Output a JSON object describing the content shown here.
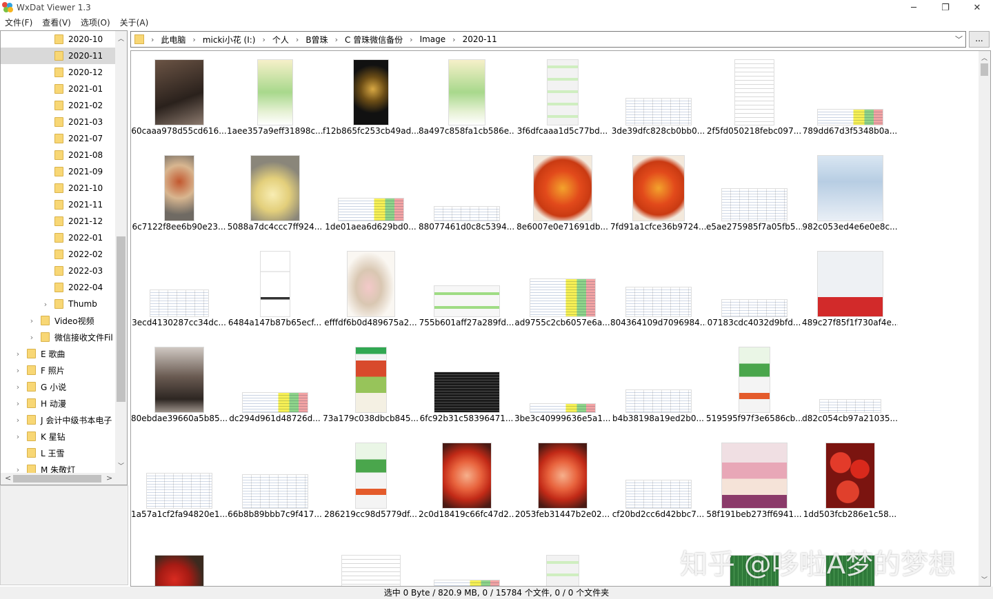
{
  "window": {
    "title": "WxDat Viewer 1.3",
    "controls": [
      "─",
      "❐",
      "✕"
    ]
  },
  "menu": [
    "文件(F)",
    "查看(V)",
    "选项(O)",
    "关于(A)"
  ],
  "tree": {
    "items": [
      {
        "label": "2020-10",
        "level": 4,
        "expander": false,
        "selected": false
      },
      {
        "label": "2020-11",
        "level": 4,
        "expander": false,
        "selected": true
      },
      {
        "label": "2020-12",
        "level": 4,
        "expander": false,
        "selected": false
      },
      {
        "label": "2021-01",
        "level": 4,
        "expander": false,
        "selected": false
      },
      {
        "label": "2021-02",
        "level": 4,
        "expander": false,
        "selected": false
      },
      {
        "label": "2021-03",
        "level": 4,
        "expander": false,
        "selected": false
      },
      {
        "label": "2021-07",
        "level": 4,
        "expander": false,
        "selected": false
      },
      {
        "label": "2021-08",
        "level": 4,
        "expander": false,
        "selected": false
      },
      {
        "label": "2021-09",
        "level": 4,
        "expander": false,
        "selected": false
      },
      {
        "label": "2021-10",
        "level": 4,
        "expander": false,
        "selected": false
      },
      {
        "label": "2021-11",
        "level": 4,
        "expander": false,
        "selected": false
      },
      {
        "label": "2021-12",
        "level": 4,
        "expander": false,
        "selected": false
      },
      {
        "label": "2022-01",
        "level": 4,
        "expander": false,
        "selected": false
      },
      {
        "label": "2022-02",
        "level": 4,
        "expander": false,
        "selected": false
      },
      {
        "label": "2022-03",
        "level": 4,
        "expander": false,
        "selected": false
      },
      {
        "label": "2022-04",
        "level": 4,
        "expander": false,
        "selected": false
      },
      {
        "label": "Thumb",
        "level": 4,
        "expander": true,
        "selected": false
      },
      {
        "label": "Video视频",
        "level": 3,
        "expander": true,
        "selected": false
      },
      {
        "label": "微信接收文件Fil",
        "level": 3,
        "expander": true,
        "selected": false
      },
      {
        "label": "E  歌曲",
        "level": 2,
        "expander": true,
        "selected": false
      },
      {
        "label": "F  照片",
        "level": 2,
        "expander": true,
        "selected": false
      },
      {
        "label": "G 小说",
        "level": 2,
        "expander": true,
        "selected": false
      },
      {
        "label": "H  动漫",
        "level": 2,
        "expander": true,
        "selected": false
      },
      {
        "label": "J  会计中级书本电子",
        "level": 2,
        "expander": true,
        "selected": false
      },
      {
        "label": "K  星钻",
        "level": 2,
        "expander": true,
        "selected": false
      },
      {
        "label": "L   王雪",
        "level": 2,
        "expander": false,
        "selected": false
      },
      {
        "label": "M  朱敬灯",
        "level": 2,
        "expander": true,
        "selected": false
      }
    ]
  },
  "address": {
    "crumbs": [
      "此电脑",
      "micki小花 (I:)",
      "个人",
      "B曾珠",
      "C  曾珠微信备份",
      "Image",
      "2020-11"
    ],
    "more_label": "..."
  },
  "files": [
    {
      "name": "60caaa978d55cd616...",
      "kind": "photo-dark",
      "w": 72,
      "h": 96
    },
    {
      "name": "1aee357a9eff31898c...",
      "kind": "game",
      "w": 52,
      "h": 96
    },
    {
      "name": "f12b865fc253cb49ad...",
      "kind": "black-gold",
      "w": 52,
      "h": 96
    },
    {
      "name": "8a497c858fa1cb586e...",
      "kind": "game",
      "w": 54,
      "h": 96
    },
    {
      "name": "3f6dfcaaa1d5c77bd...",
      "kind": "chat",
      "w": 46,
      "h": 96
    },
    {
      "name": "3de39dfc828cb0bb0...",
      "kind": "sheet",
      "w": 96,
      "h": 40
    },
    {
      "name": "2f5fd050218febc097...",
      "kind": "doc",
      "w": 58,
      "h": 96
    },
    {
      "name": "789dd67d3f5348b0a...",
      "kind": "sheet-color",
      "w": 96,
      "h": 24
    },
    {
      "name": "6c7122f8ee6b90e23...",
      "kind": "food",
      "w": 44,
      "h": 96
    },
    {
      "name": "5088a7dc4ccc7ff924...",
      "kind": "lemon",
      "w": 72,
      "h": 96
    },
    {
      "name": "1de01aea6d629bd0...",
      "kind": "sheet-color",
      "w": 96,
      "h": 34
    },
    {
      "name": "88077461d0c8c5394...",
      "kind": "sheet",
      "w": 96,
      "h": 22
    },
    {
      "name": "8e6007e0e71691db...",
      "kind": "tomato-egg",
      "w": 86,
      "h": 96
    },
    {
      "name": "7fd91a1cfce36b9724...",
      "kind": "tomato-egg",
      "w": 76,
      "h": 96
    },
    {
      "name": "e5ae275985f7a05fb5...",
      "kind": "sheet",
      "w": 96,
      "h": 48
    },
    {
      "name": "982c053ed4e6e0e8c...",
      "kind": "product",
      "w": 96,
      "h": 96
    },
    {
      "name": "3ecd4130287cc34dc...",
      "kind": "sheet",
      "w": 86,
      "h": 40
    },
    {
      "name": "6484a147b87b65ecf...",
      "kind": "receipt",
      "w": 44,
      "h": 96
    },
    {
      "name": "efffdf6b0d489675a2...",
      "kind": "drawing",
      "w": 70,
      "h": 96
    },
    {
      "name": "755b601aff27a289fd...",
      "kind": "chat-light",
      "w": 96,
      "h": 46
    },
    {
      "name": "ad9755c2cb6057e6a...",
      "kind": "sheet-color",
      "w": 96,
      "h": 56
    },
    {
      "name": "804364109d7096984...",
      "kind": "sheet",
      "w": 96,
      "h": 44
    },
    {
      "name": "07183cdc4032d9bfd...",
      "kind": "sheet",
      "w": 96,
      "h": 26
    },
    {
      "name": "489c27f85f1f730af4e...",
      "kind": "ad-red",
      "w": 96,
      "h": 96
    },
    {
      "name": "80ebdae39660a5b85...",
      "kind": "photo-people",
      "w": 72,
      "h": 96
    },
    {
      "name": "dc294d961d48726d...",
      "kind": "sheet-color",
      "w": 96,
      "h": 30
    },
    {
      "name": "73a179c038dbcb845...",
      "kind": "app-food",
      "w": 46,
      "h": 96
    },
    {
      "name": "6fc92b31c58396471...",
      "kind": "terminal",
      "w": 96,
      "h": 60
    },
    {
      "name": "3be3c40999636e5a1...",
      "kind": "sheet-color",
      "w": 96,
      "h": 14
    },
    {
      "name": "b4b38198a19ed2b0...",
      "kind": "sheet",
      "w": 96,
      "h": 34
    },
    {
      "name": "519595f97f3e6586cb...",
      "kind": "app-green",
      "w": 46,
      "h": 96
    },
    {
      "name": "d82c054cb97a21035...",
      "kind": "sheet",
      "w": 90,
      "h": 20
    },
    {
      "name": "1a57a1cf2fa94820e1...",
      "kind": "sheet",
      "w": 96,
      "h": 52
    },
    {
      "name": "66b8b89bbb7c9f417...",
      "kind": "sheet",
      "w": 96,
      "h": 50
    },
    {
      "name": "286219cc98d5779df...",
      "kind": "app-green",
      "w": 46,
      "h": 96
    },
    {
      "name": "2c0d18419c66fc47d2...",
      "kind": "tomato-cut",
      "w": 72,
      "h": 96
    },
    {
      "name": "2053feb31447b2e02...",
      "kind": "tomato-cut",
      "w": 72,
      "h": 96
    },
    {
      "name": "cf20bd2cc6d42bbc7...",
      "kind": "sheet",
      "w": 96,
      "h": 42
    },
    {
      "name": "58f191beb273ff6941...",
      "kind": "towel",
      "w": 96,
      "h": 96
    },
    {
      "name": "1dd503fcb286e1c58...",
      "kind": "tomatoes",
      "w": 72,
      "h": 96
    },
    {
      "name": "",
      "kind": "strawberry",
      "w": 72,
      "h": 72
    },
    {
      "name": "",
      "kind": "sheet",
      "w": 96,
      "h": 14
    },
    {
      "name": "",
      "kind": "doc",
      "w": 86,
      "h": 72
    },
    {
      "name": "",
      "kind": "sheet-color",
      "w": 96,
      "h": 36
    },
    {
      "name": "",
      "kind": "chat",
      "w": 48,
      "h": 72
    },
    {
      "name": "",
      "kind": "sheet",
      "w": 96,
      "h": 12
    },
    {
      "name": "",
      "kind": "pcb",
      "w": 72,
      "h": 72
    },
    {
      "name": "",
      "kind": "pcb",
      "w": 72,
      "h": 72
    }
  ],
  "watermark": "知乎 @哆啦A梦的梦想",
  "status": "选中 0 Byte / 820.9 MB, 0 / 15784 个文件, 0 / 0 个文件夹"
}
